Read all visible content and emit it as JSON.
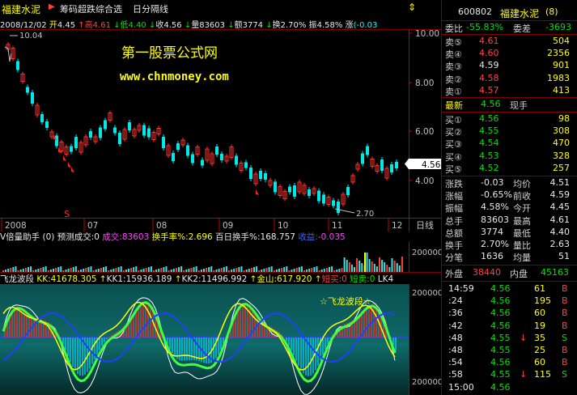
{
  "header": {
    "stock_name": "福建水泥",
    "indicator_name": "筹码超跌综合选",
    "mode": "日分隔线",
    "date": "2008/12/02",
    "open_label": "开",
    "open": "4.45",
    "high_label": "高",
    "high": "4.61",
    "low_label": "低",
    "low": "4.40",
    "close_label": "收",
    "close": "4.56",
    "vol_label": "量",
    "vol": "83603",
    "amount_label": "额",
    "amount": "3774",
    "turnover_label": "换",
    "turnover": "2.70%",
    "amplitude_label": "振",
    "amplitude": "4.58%",
    "change_label": "涨",
    "change": "(-0.03"
  },
  "watermark": {
    "line1": "第一股票公式网",
    "line2": "www.chnmoney.com"
  },
  "price_axis": [
    "10.00",
    "8.00",
    "6.00",
    "4.00"
  ],
  "price_tag": "4.56",
  "peak_label": "10.04",
  "low_mark": "2.70",
  "s_mark": "S",
  "xaxis": [
    "2008",
    "07",
    "08",
    "09",
    "10",
    "11",
    "12"
  ],
  "period_label": "日线",
  "volume_panel": {
    "name": "V倍量助手",
    "param": "(0)",
    "forecast": "预测成交:0",
    "deal_label": "成交:",
    "deal": "83603",
    "turnover_label": "换手率%:",
    "turnover": "2.696",
    "hundred_label": "百日换手%:",
    "hundred": "168.757",
    "earn_label": "收益:",
    "earn": "-0.035",
    "axis": "200000"
  },
  "fly_panel": {
    "name": "飞龙波段",
    "kk_label": "KK:",
    "kk": "41678.305",
    "kk1_label": "KK1:",
    "kk1": "15936.189",
    "kk2_label": "KK2:",
    "kk2": "11496.992",
    "gold_label": "金山:",
    "gold": "617.920",
    "short_label": "短买:",
    "short": "0",
    "short2_label": "短卖:",
    "short2": "0",
    "lk_label": "LK4",
    "title_tag": "☆飞龙波段☆",
    "axis_top": "200000",
    "axis_bottom": "200000"
  },
  "quote": {
    "code": "600802",
    "name": "福建水泥",
    "num": "(8)",
    "ratio_label": "委比",
    "ratio": "-55.83%",
    "diff_label": "委差",
    "diff": "-3693",
    "asks": [
      {
        "label": "卖⑤",
        "price": "4.61",
        "vol": "504"
      },
      {
        "label": "卖④",
        "price": "4.60",
        "vol": "2356"
      },
      {
        "label": "卖③",
        "price": "4.59",
        "vol": "901"
      },
      {
        "label": "卖②",
        "price": "4.58",
        "vol": "1983"
      },
      {
        "label": "卖①",
        "price": "4.57",
        "vol": "413"
      }
    ],
    "last_label": "最新",
    "last": "4.56",
    "cur_label": "现手",
    "bids": [
      {
        "label": "买①",
        "price": "4.56",
        "vol": "98"
      },
      {
        "label": "买②",
        "price": "4.55",
        "vol": "308"
      },
      {
        "label": "买③",
        "price": "4.54",
        "vol": "470"
      },
      {
        "label": "买④",
        "price": "4.53",
        "vol": "328"
      },
      {
        "label": "买⑤",
        "price": "4.52",
        "vol": "257"
      }
    ],
    "stats": [
      {
        "l1": "涨跌",
        "v1": "-0.03",
        "l2": "均价",
        "v2": "4.51"
      },
      {
        "l1": "涨幅",
        "v1": "-0.65%",
        "l2": "前收",
        "v2": "4.59"
      },
      {
        "l1": "振幅",
        "v1": "4.58%",
        "l2": "今开",
        "v2": "4.45"
      },
      {
        "l1": "总手",
        "v1": "83603",
        "l2": "最高",
        "v2": "4.61"
      },
      {
        "l1": "总额",
        "v1": "3774",
        "l2": "最低",
        "v2": "4.40"
      },
      {
        "l1": "换手",
        "v1": "2.70%",
        "l2": "量比",
        "v2": "2.63"
      },
      {
        "l1": "分笔",
        "v1": "1636",
        "l2": "均量",
        "v2": "51"
      }
    ],
    "outer_label": "外盘",
    "outer": "38440",
    "inner_label": "内盘",
    "inner": "45163",
    "ticks": [
      {
        "time": "14:59",
        "price": "4.56",
        "vol": "61",
        "flag": "B"
      },
      {
        "time": ":24",
        "price": "4.56",
        "vol": "195",
        "flag": "B"
      },
      {
        "time": ":36",
        "price": "4.56",
        "vol": "60",
        "flag": "B"
      },
      {
        "time": ":42",
        "price": "4.56",
        "vol": "19",
        "flag": "B"
      },
      {
        "time": ":48",
        "price": "4.55",
        "vol": "35",
        "flag": "S"
      },
      {
        "time": ":48",
        "price": "4.55",
        "vol": "25",
        "flag": "B"
      },
      {
        "time": ":54",
        "price": "4.56",
        "vol": "60",
        "flag": "B"
      },
      {
        "time": ":58",
        "price": "4.55",
        "vol": "115",
        "flag": "S"
      },
      {
        "time": "15:00",
        "price": "4.56",
        "vol": "",
        "flag": ""
      }
    ]
  },
  "colors": {
    "up": "#ff3030",
    "down": "#00ffff",
    "grid": "#800000",
    "axis": "#c00000"
  }
}
